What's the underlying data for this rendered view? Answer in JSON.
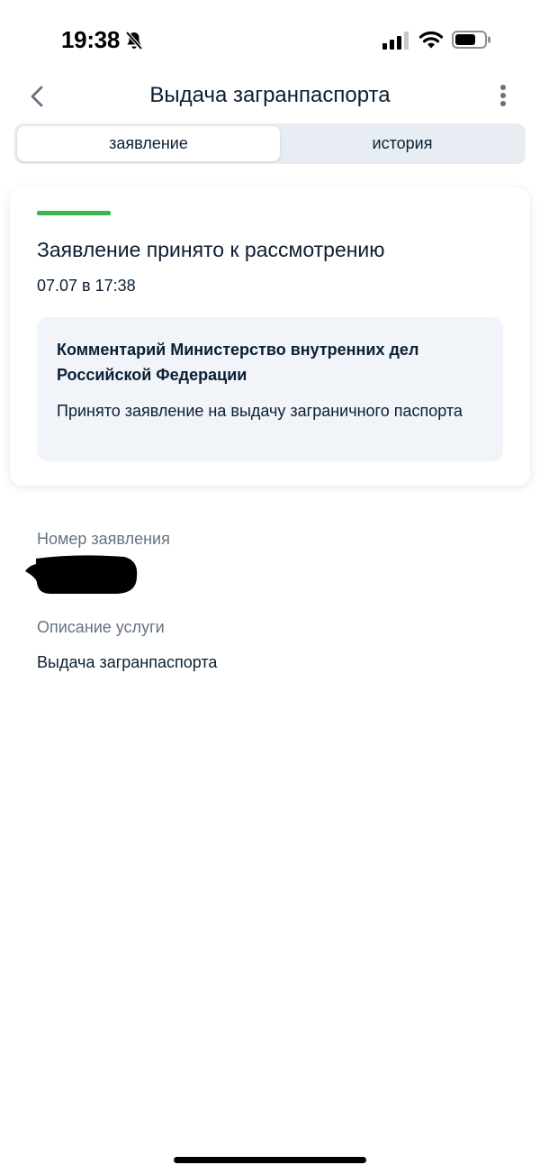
{
  "status_bar": {
    "time": "19:38",
    "icons": [
      "bell-slash-icon",
      "cellular-signal-icon",
      "wifi-icon",
      "battery-icon"
    ]
  },
  "nav": {
    "title": "Выдача загранпаспорта",
    "back_icon": "chevron-left-icon",
    "more_icon": "more-vertical-icon"
  },
  "tabs": [
    {
      "label": "заявление",
      "active": true
    },
    {
      "label": "история",
      "active": false
    }
  ],
  "status_card": {
    "status_color": "#3ab54a",
    "title": "Заявление принято к рассмотрению",
    "date": "07.07 в 17:38",
    "comment": {
      "heading": "Комментарий Министерство внутренних дел Российской Федерации",
      "text": "Принято заявление на выдачу заграничного паспорта"
    }
  },
  "details": {
    "application_number": {
      "label": "Номер заявления"
    },
    "service_description": {
      "label": "Описание услуги",
      "value": "Выдача загранпаспорта"
    }
  },
  "colors": {
    "accent_green": "#3ab54a",
    "text_primary": "#0b1f33",
    "text_secondary": "#66727f",
    "tab_bg": "#e8edf3",
    "comment_bg": "#f1f4f9"
  }
}
